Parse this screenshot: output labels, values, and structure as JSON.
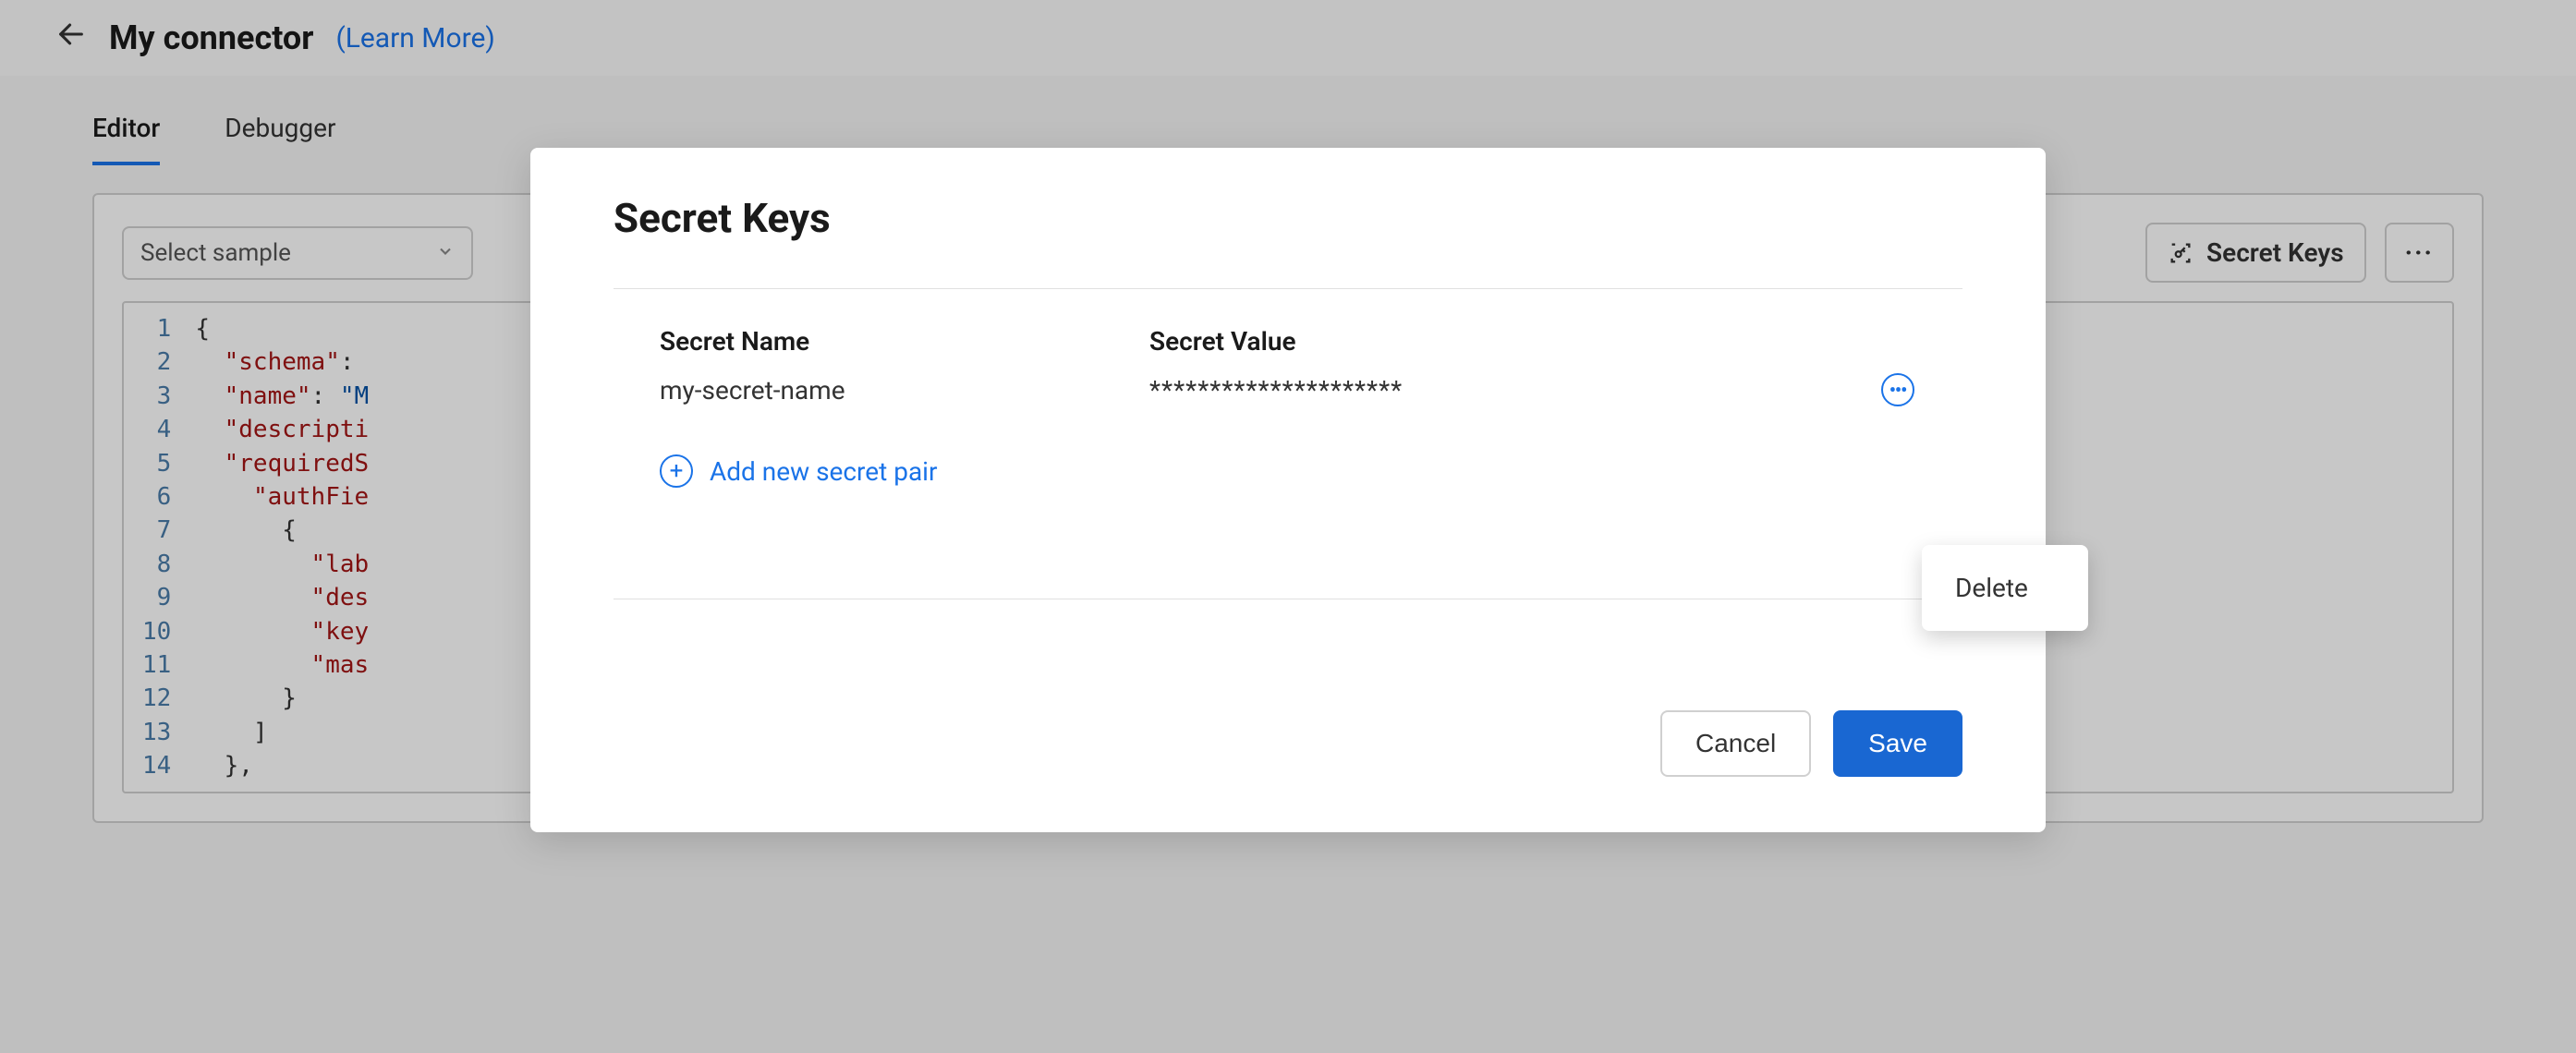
{
  "header": {
    "title": "My connector",
    "learn_more": "(Learn More)"
  },
  "tabs": [
    {
      "label": "Editor",
      "active": true
    },
    {
      "label": "Debugger",
      "active": false
    }
  ],
  "toolbar": {
    "sample_placeholder": "Select sample",
    "secret_keys_label": "Secret Keys"
  },
  "editor": {
    "lines": [
      "{",
      "  \"schema\": ",
      "  \"name\": \"M",
      "  \"descripti",
      "  \"requiredS",
      "    \"authFie",
      "      {",
      "        \"lab",
      "        \"des",
      "        \"key",
      "        \"mas",
      "      }",
      "    ]",
      "  },"
    ]
  },
  "modal": {
    "title": "Secret Keys",
    "col_name": "Secret Name",
    "col_value": "Secret Value",
    "rows": [
      {
        "name": "my-secret-name",
        "value": "*********************"
      }
    ],
    "add_label": "Add new secret pair",
    "dropdown": {
      "delete": "Delete"
    },
    "cancel": "Cancel",
    "save": "Save"
  }
}
